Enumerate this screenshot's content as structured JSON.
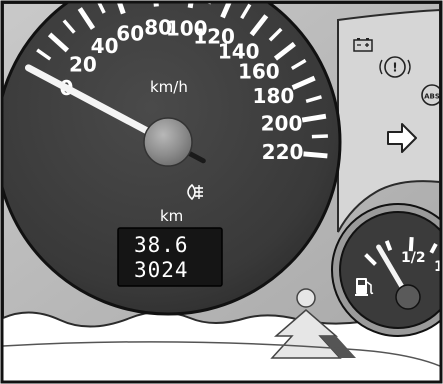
{
  "speedometer": {
    "unit": "km/h",
    "scale_labels": [
      "0",
      "20",
      "40",
      "60",
      "80",
      "100",
      "120",
      "140",
      "160",
      "180",
      "200",
      "220"
    ],
    "reading_kmh": 0
  },
  "odometer": {
    "unit": "km",
    "trip": "38.6",
    "total": "3024"
  },
  "fuel_gauge": {
    "labels": [
      "1/2",
      "1"
    ],
    "level": 0.15
  },
  "indicators": [
    "fog-light-icon",
    "battery-icon",
    "brake-warning-icon",
    "abs-icon",
    "turn-signal-arrow-icon",
    "fuel-pump-icon"
  ],
  "colors": {
    "dial": "#3d3d3d",
    "housing": "#bdbdbd",
    "text": "#ffffff",
    "outline": "#111111"
  }
}
